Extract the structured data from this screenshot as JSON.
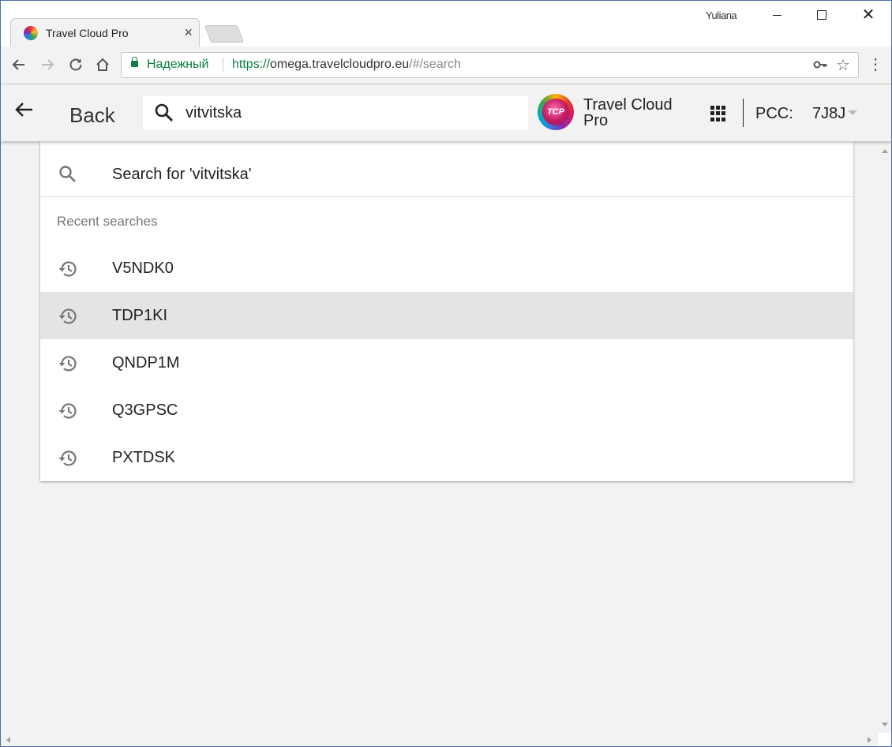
{
  "browser": {
    "tab_title": "Travel Cloud Pro",
    "tab_close": "×",
    "user_name": "Yuliana",
    "secure_label": "Надежный",
    "url_scheme": "https://",
    "url_host": "omega.travelcloudpro.eu",
    "url_path": "/#/search"
  },
  "header": {
    "back_label": "Back",
    "search_value": "vitvitska",
    "logo_text": "TCP",
    "brand_name": "Travel Cloud Pro",
    "pcc_label": "PCC:",
    "pcc_value": "7J8J"
  },
  "dropdown": {
    "search_suggestion": "Search for 'vitvitska'",
    "recent_heading": "Recent searches",
    "recent_items": [
      {
        "label": "V5NDK0"
      },
      {
        "label": "TDP1KI"
      },
      {
        "label": "QNDP1M"
      },
      {
        "label": "Q3GPSC"
      },
      {
        "label": "PXTDSK"
      }
    ],
    "highlighted_index": 1
  },
  "colors": {
    "secure_green": "#0b8043",
    "highlight_row": "#e4e4e4",
    "page_background": "#f2f2f2"
  },
  "icons": {
    "tab_favicon": "travel-cloud-pro-favicon",
    "back": "arrow-left-icon",
    "search": "search-icon",
    "recent": "history-icon",
    "apps": "apps-grid-icon",
    "pcc_dropdown": "chevron-down-icon"
  }
}
